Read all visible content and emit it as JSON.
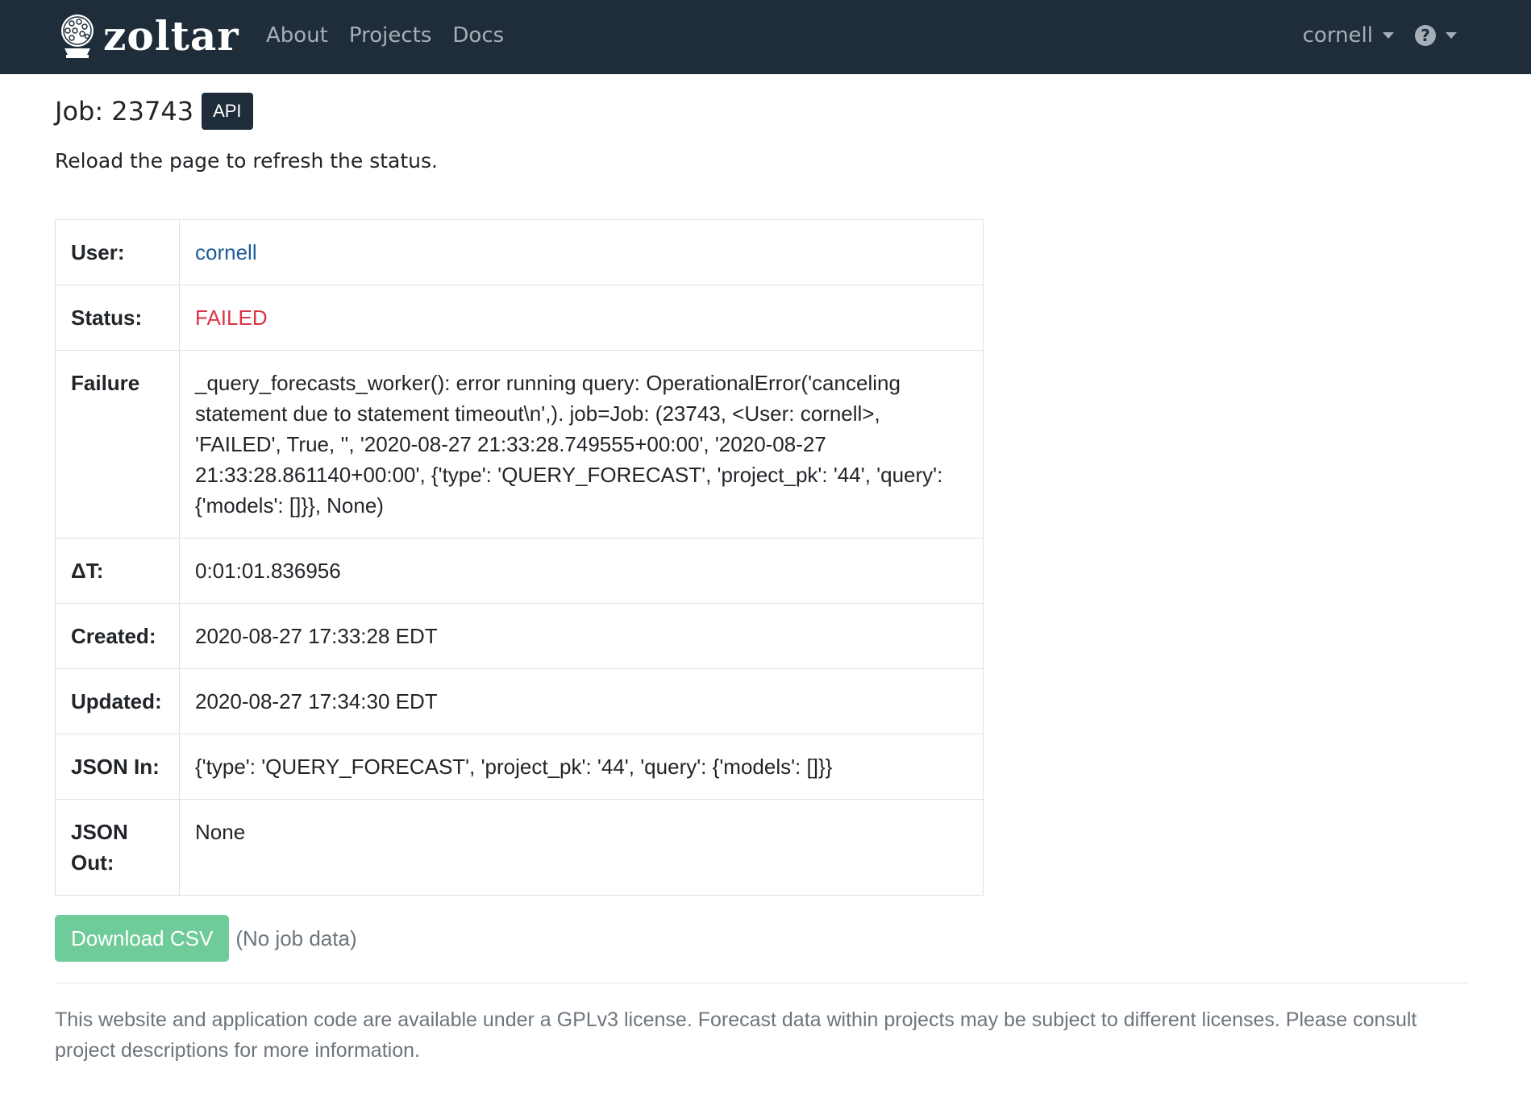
{
  "navbar": {
    "brand": "zoltar",
    "links": [
      "About",
      "Projects",
      "Docs"
    ],
    "user_menu": "cornell",
    "help_icon": "question-circle-icon"
  },
  "header": {
    "title": "Job: 23743",
    "api_badge": "API",
    "reload_note": "Reload the page to refresh the status."
  },
  "details": {
    "user_label": "User:",
    "user_value": "cornell",
    "status_label": "Status:",
    "status_value": "FAILED",
    "failure_label": "Failure",
    "failure_value": "_query_forecasts_worker(): error running query: OperationalError('canceling statement due to statement timeout\\n',). job=Job: (23743, <User: cornell>, 'FAILED', True, '', '2020-08-27 21:33:28.749555+00:00', '2020-08-27 21:33:28.861140+00:00', {'type': 'QUERY_FORECAST', 'project_pk': '44', 'query': {'models': []}}, None)",
    "delta_label": "ΔT:",
    "delta_value": "0:01:01.836956",
    "created_label": "Created:",
    "created_value": "2020-08-27 17:33:28 EDT",
    "updated_label": "Updated:",
    "updated_value": "2020-08-27 17:34:30 EDT",
    "json_in_label": "JSON In:",
    "json_in_value": "{'type': 'QUERY_FORECAST', 'project_pk': '44', 'query': {'models': []}}",
    "json_out_label": "JSON Out:",
    "json_out_value": "None"
  },
  "actions": {
    "download_label": "Download CSV",
    "no_data_note": "(No job data)"
  },
  "footer": {
    "text": "This website and application code are available under a GPLv3 license. Forecast data within projects may be subject to different licenses. Please consult project descriptions for more information."
  },
  "colors": {
    "navbar_bg": "#1f2d3a",
    "link": "#1d5d99",
    "status_failed": "#dc3545",
    "download_button": "#6fcb99"
  }
}
